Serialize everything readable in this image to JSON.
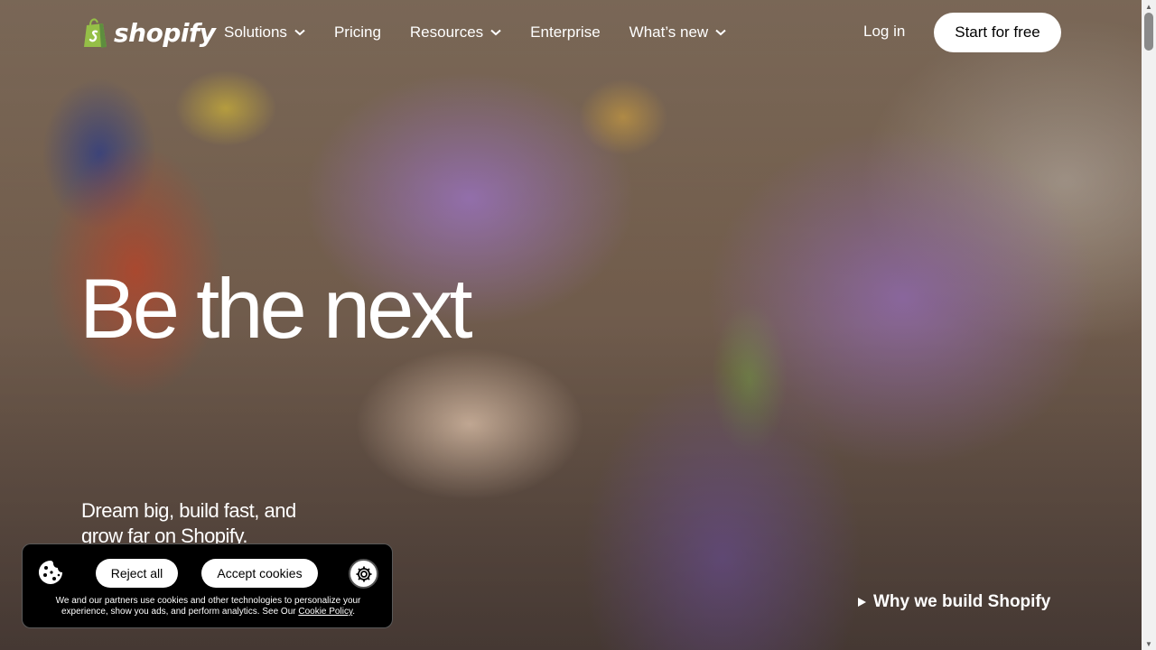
{
  "brand": {
    "name": "shopify",
    "logo_icon": "shopify-bag-icon",
    "logo_color": "#95bf47"
  },
  "nav": {
    "items": [
      {
        "label": "Solutions",
        "has_dropdown": true
      },
      {
        "label": "Pricing",
        "has_dropdown": false
      },
      {
        "label": "Resources",
        "has_dropdown": true
      },
      {
        "label": "Enterprise",
        "has_dropdown": false
      },
      {
        "label": "What’s new",
        "has_dropdown": true
      }
    ],
    "login_label": "Log in",
    "cta_label": "Start for free"
  },
  "hero": {
    "headline": "Be the next",
    "subhead": "Dream big, build fast, and grow far on Shopify.",
    "video_link": "Why we build Shopify",
    "video_icon": "play-icon"
  },
  "cookie_banner": {
    "icon": "cookie-icon",
    "reject_label": "Reject all",
    "accept_label": "Accept cookies",
    "settings_icon": "gear-icon",
    "text": "We and our partners use cookies and other technologies to personalize your experience, show you ads, and perform analytics. See Our ",
    "link_label": "Cookie Policy",
    "text_end": "."
  },
  "colors": {
    "accent": "#ffffff",
    "banner_bg": "#000000"
  }
}
